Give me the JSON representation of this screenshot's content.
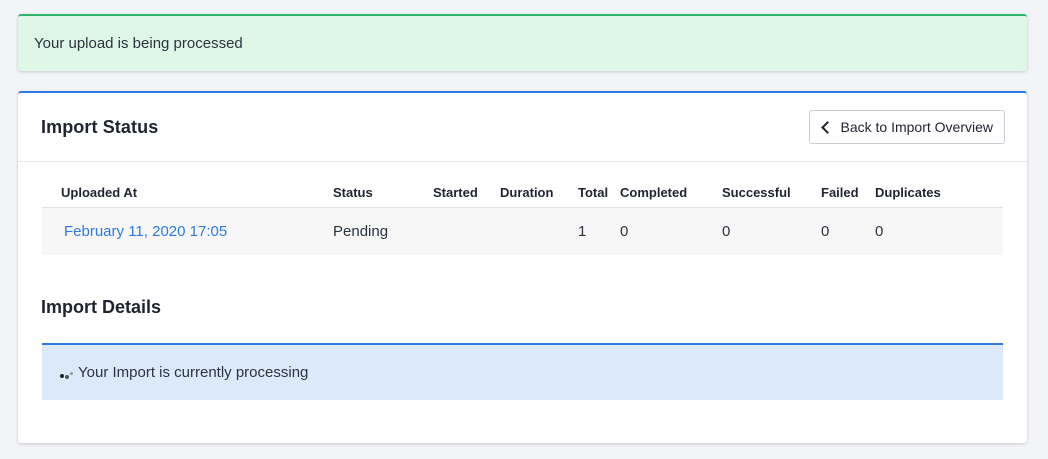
{
  "notice": {
    "text": "Your upload is being processed"
  },
  "card": {
    "title": "Import Status",
    "back_button_label": "Back to Import Overview"
  },
  "table": {
    "headers": [
      "Uploaded At",
      "Status",
      "Started",
      "Duration",
      "Total",
      "Completed",
      "Successful",
      "Failed",
      "Duplicates"
    ],
    "rows": [
      [
        "February 11, 2020 17:05",
        "Pending",
        "",
        "",
        "1",
        "0",
        "0",
        "0",
        "0"
      ]
    ]
  },
  "details": {
    "title": "Import Details",
    "processing_text": "Your Import is currently processing"
  },
  "colors": {
    "accent": "#2d7be0",
    "success_bg": "#dff7e7",
    "info_bg": "#dbe9fb"
  }
}
